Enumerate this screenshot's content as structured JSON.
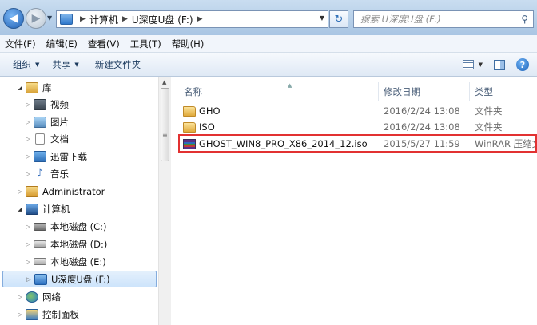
{
  "addressbar": {
    "breadcrumb": [
      "计算机",
      "U深度U盘 (F:)"
    ],
    "search_placeholder": "搜索 U深度U盘 (F:)"
  },
  "menubar": {
    "items": [
      "文件(F)",
      "编辑(E)",
      "查看(V)",
      "工具(T)",
      "帮助(H)"
    ]
  },
  "toolbar": {
    "organize": "组织",
    "share": "共享",
    "new_folder": "新建文件夹"
  },
  "navpane": {
    "items": [
      {
        "label": "库",
        "icon": "library-icon",
        "expander": "open"
      },
      {
        "label": "视频",
        "icon": "video-icon",
        "expander": "closed"
      },
      {
        "label": "图片",
        "icon": "pictures-icon",
        "expander": "closed"
      },
      {
        "label": "文档",
        "icon": "documents-icon",
        "expander": "closed"
      },
      {
        "label": "迅雷下载",
        "icon": "xunlei-icon",
        "expander": "closed"
      },
      {
        "label": "音乐",
        "icon": "music-icon",
        "expander": "closed"
      },
      {
        "label": "Administrator",
        "icon": "user-folder-icon",
        "expander": "closed"
      },
      {
        "label": "计算机",
        "icon": "computer-icon",
        "expander": "open"
      },
      {
        "label": "本地磁盘 (C:)",
        "icon": "system-drive-icon",
        "expander": "closed"
      },
      {
        "label": "本地磁盘 (D:)",
        "icon": "drive-icon",
        "expander": "closed"
      },
      {
        "label": "本地磁盘 (E:)",
        "icon": "drive-icon",
        "expander": "closed"
      },
      {
        "label": "U深度U盘 (F:)",
        "icon": "usb-drive-icon",
        "expander": "closed",
        "selected": true
      },
      {
        "label": "网络",
        "icon": "network-icon",
        "expander": "closed"
      },
      {
        "label": "控制面板",
        "icon": "control-panel-icon",
        "expander": "closed"
      }
    ]
  },
  "content": {
    "columns": [
      "名称",
      "修改日期",
      "类型"
    ],
    "files": [
      {
        "name": "GHO",
        "date": "2016/2/24 13:08",
        "type": "文件夹",
        "icon": "folder-icon"
      },
      {
        "name": "ISO",
        "date": "2016/2/24 13:08",
        "type": "文件夹",
        "icon": "folder-icon"
      },
      {
        "name": "GHOST_WIN8_PRO_X86_2014_12.iso",
        "date": "2015/5/27 11:59",
        "type": "WinRAR 压缩文",
        "icon": "winrar-archive-icon",
        "highlighted": true
      }
    ]
  },
  "colors": {
    "highlight_border": "#e23131",
    "selection_bg": "#cde4fb",
    "chrome_blue": "#a9c5e3"
  }
}
